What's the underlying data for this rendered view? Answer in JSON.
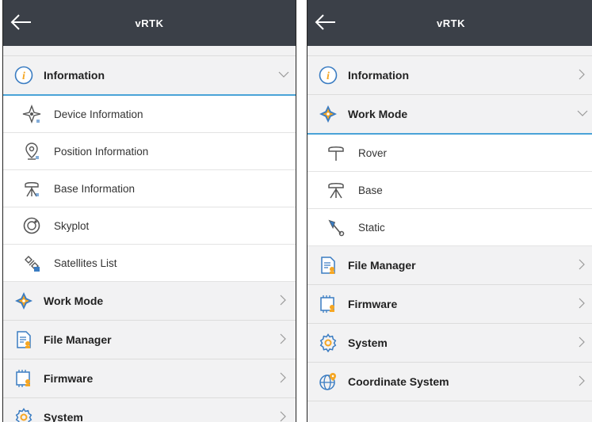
{
  "left": {
    "title": "vRTK",
    "expanded": {
      "label": "Information"
    },
    "submenu": [
      {
        "label": "Device Information"
      },
      {
        "label": "Position Information"
      },
      {
        "label": "Base Information"
      },
      {
        "label": "Skyplot"
      },
      {
        "label": "Satellites List"
      }
    ],
    "menu": [
      {
        "label": "Work Mode"
      },
      {
        "label": "File Manager"
      },
      {
        "label": "Firmware"
      },
      {
        "label": "System"
      }
    ]
  },
  "right": {
    "title": "vRTK",
    "top_menu": [
      {
        "label": "Information"
      }
    ],
    "expanded": {
      "label": "Work Mode"
    },
    "submenu": [
      {
        "label": "Rover"
      },
      {
        "label": "Base"
      },
      {
        "label": "Static"
      }
    ],
    "menu": [
      {
        "label": "File Manager"
      },
      {
        "label": "Firmware"
      },
      {
        "label": "System"
      },
      {
        "label": "Coordinate System"
      }
    ]
  },
  "colors": {
    "topbar": "#3b4048",
    "accent": "#f5a623",
    "blue": "#3a7cc2",
    "divider_active": "#4aa3d8"
  }
}
